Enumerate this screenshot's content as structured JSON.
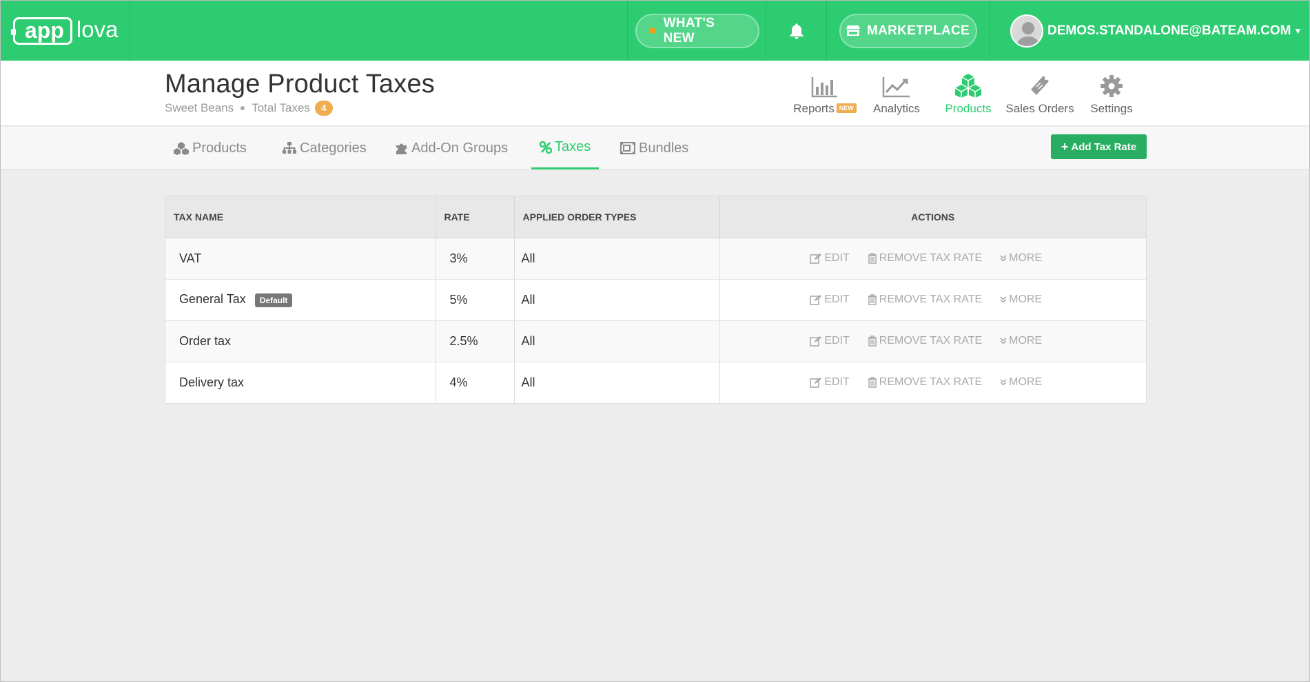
{
  "app": {
    "logo_app": "app",
    "logo_lova": "lova"
  },
  "topbar": {
    "whats_new": "WHAT'S NEW",
    "marketplace": "MARKETPLACE",
    "user_email": "DEMOS.STANDALONE@BATEAM.COM"
  },
  "header": {
    "title": "Manage Product Taxes",
    "store": "Sweet Beans",
    "total_label": "Total Taxes",
    "total_count": "4"
  },
  "mainnav": [
    {
      "label": "Reports",
      "badge": "NEW",
      "icon": "bar-chart-icon"
    },
    {
      "label": "Analytics",
      "icon": "line-chart-icon"
    },
    {
      "label": "Products",
      "icon": "cubes-icon",
      "active": true
    },
    {
      "label": "Sales Orders",
      "icon": "ticket-icon"
    },
    {
      "label": "Settings",
      "icon": "gear-icon"
    }
  ],
  "subtabs": [
    {
      "label": "Products",
      "icon": "cubes-icon"
    },
    {
      "label": "Categories",
      "icon": "sitemap-icon"
    },
    {
      "label": "Add-On Groups",
      "icon": "puzzle-icon"
    },
    {
      "label": "Taxes",
      "icon": "percent-icon",
      "active": true
    },
    {
      "label": "Bundles",
      "icon": "bundle-icon"
    }
  ],
  "add_button": "Add Tax Rate",
  "table": {
    "headers": [
      "TAX NAME",
      "RATE",
      "APPLIED ORDER TYPES",
      "ACTIONS"
    ],
    "rows": [
      {
        "name": "VAT",
        "rate": "3%",
        "types": "All"
      },
      {
        "name": "General Tax",
        "badge": "Default",
        "rate": "5%",
        "types": "All"
      },
      {
        "name": "Order tax",
        "rate": "2.5%",
        "types": "All"
      },
      {
        "name": "Delivery tax",
        "rate": "4%",
        "types": "All"
      }
    ],
    "actions": {
      "edit": "EDIT",
      "remove": "REMOVE TAX RATE",
      "more": "MORE"
    }
  },
  "colors": {
    "brand_green": "#2ecc71",
    "button_green": "#27ae60",
    "badge_orange": "#f0ad4e"
  }
}
